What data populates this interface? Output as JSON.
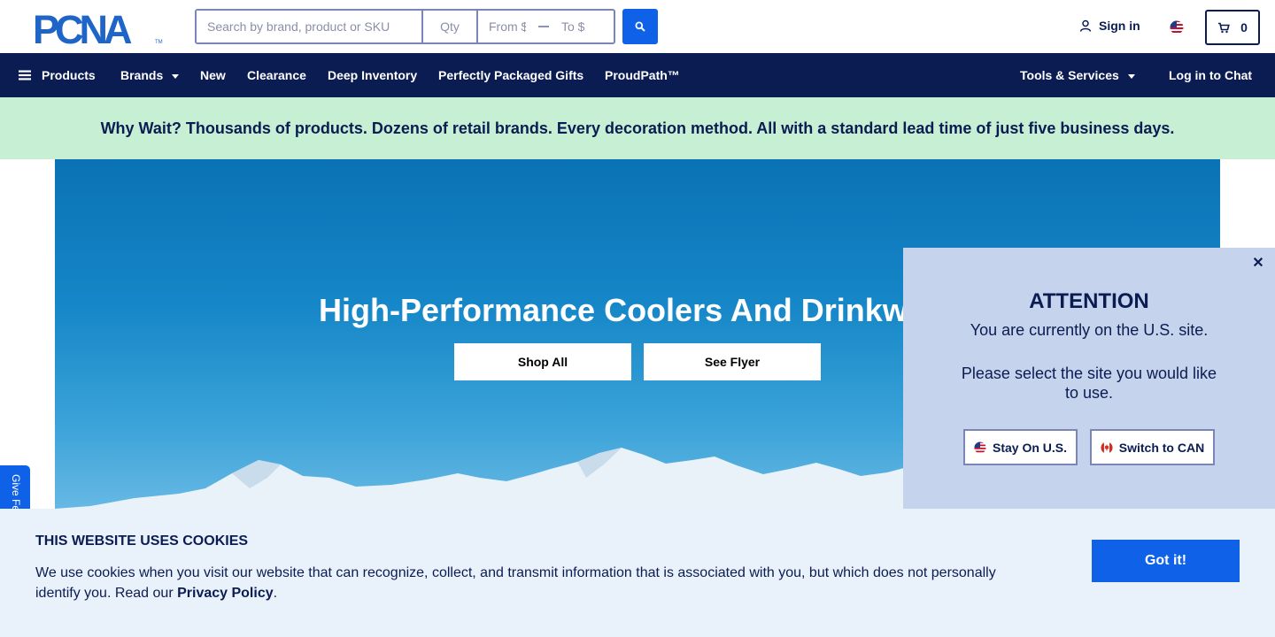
{
  "header": {
    "logo_text": "PCNA",
    "search": {
      "placeholder": "Search by brand, product or SKU",
      "value": ""
    },
    "qty": {
      "placeholder": "Qty",
      "value": ""
    },
    "price_from": {
      "placeholder": "From $",
      "value": ""
    },
    "price_to": {
      "placeholder": "To $",
      "value": ""
    },
    "search_icon": "search-icon",
    "sign_in_label": "Sign in",
    "country_flag": "us-flag-icon",
    "cart_count": "0"
  },
  "nav": {
    "products_label": "Products",
    "brands_label": "Brands",
    "new_label": "New",
    "clearance_label": "Clearance",
    "deep_inventory_label": "Deep Inventory",
    "gifts_label": "Perfectly Packaged Gifts",
    "proudpath_label": "ProudPath™",
    "tools_label": "Tools & Services",
    "chat_label": "Log in to Chat"
  },
  "banner": {
    "text": "Why Wait? Thousands of products. Dozens of retail brands. Every decoration method. All with a standard lead time of just five business days."
  },
  "hero": {
    "title": "High-Performance Coolers And Drinkw",
    "shop_all_label": "Shop All",
    "see_flyer_label": "See Flyer"
  },
  "feedback": {
    "label": "Give Fe"
  },
  "popup": {
    "title": "ATTENTION",
    "line1": "You are currently on the U.S. site.",
    "line2": "Please select the site you would like to use.",
    "stay_label": "Stay On U.S.",
    "switch_label": "Switch to CAN",
    "close_symbol": "✕"
  },
  "cookie": {
    "title": "THIS WEBSITE USES COOKIES",
    "body": "We use cookies when you visit our website that can recognize, collect, and transmit information that is associated with you, but which does not personally identify you. Read our ",
    "link_label": "Privacy Policy",
    "period": ".",
    "button_label": "Got it!"
  },
  "colors": {
    "navy": "#0b1c52",
    "accent_blue": "#0f62e8",
    "banner_green": "#c6efd3",
    "popup_bg": "#c5d3ec",
    "cookie_bg": "#e9f1fb"
  }
}
